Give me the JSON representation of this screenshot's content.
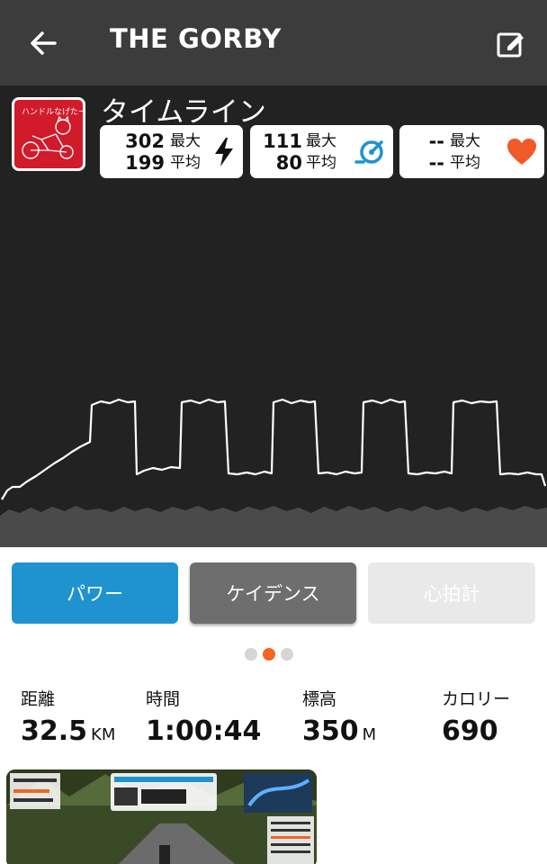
{
  "header": {
    "title": "THE GORBY",
    "back_icon": "arrow-left-icon",
    "edit_icon": "edit-icon"
  },
  "timeline": {
    "title": "タイムライン",
    "avatar_text": "ハンドルなげたー"
  },
  "stats": {
    "power": {
      "max": "302",
      "avg": "199",
      "max_label": "最大",
      "avg_label": "平均",
      "icon": "lightning-icon"
    },
    "cadence": {
      "max": "111",
      "avg": "80",
      "max_label": "最大",
      "avg_label": "平均",
      "icon": "cadence-icon"
    },
    "heart_rate": {
      "max": "--",
      "avg": "--",
      "max_label": "最大",
      "avg_label": "平均",
      "icon": "heart-icon"
    }
  },
  "tabs": {
    "power": "パワー",
    "cadence": "ケイデンス",
    "heart_rate": "心拍計"
  },
  "pager": {
    "count": 3,
    "active": 2
  },
  "metrics": {
    "distance": {
      "label": "距離",
      "value": "32.5",
      "unit": "KM"
    },
    "time": {
      "label": "時間",
      "value": "1:00:44"
    },
    "elevation": {
      "label": "標高",
      "value": "350",
      "unit": "M"
    },
    "calories": {
      "label": "カロリー",
      "value": "690"
    }
  },
  "colors": {
    "header_bg": "#3c3c3c",
    "chart_bg": "#222222",
    "power_tab": "#1e93d0",
    "cadence_tab": "#6e6e6e",
    "hr_tab": "#e9e9e9",
    "accent": "#f26522",
    "cadence_icon": "#1e93d0",
    "heart_icon": "#f05a28"
  }
}
